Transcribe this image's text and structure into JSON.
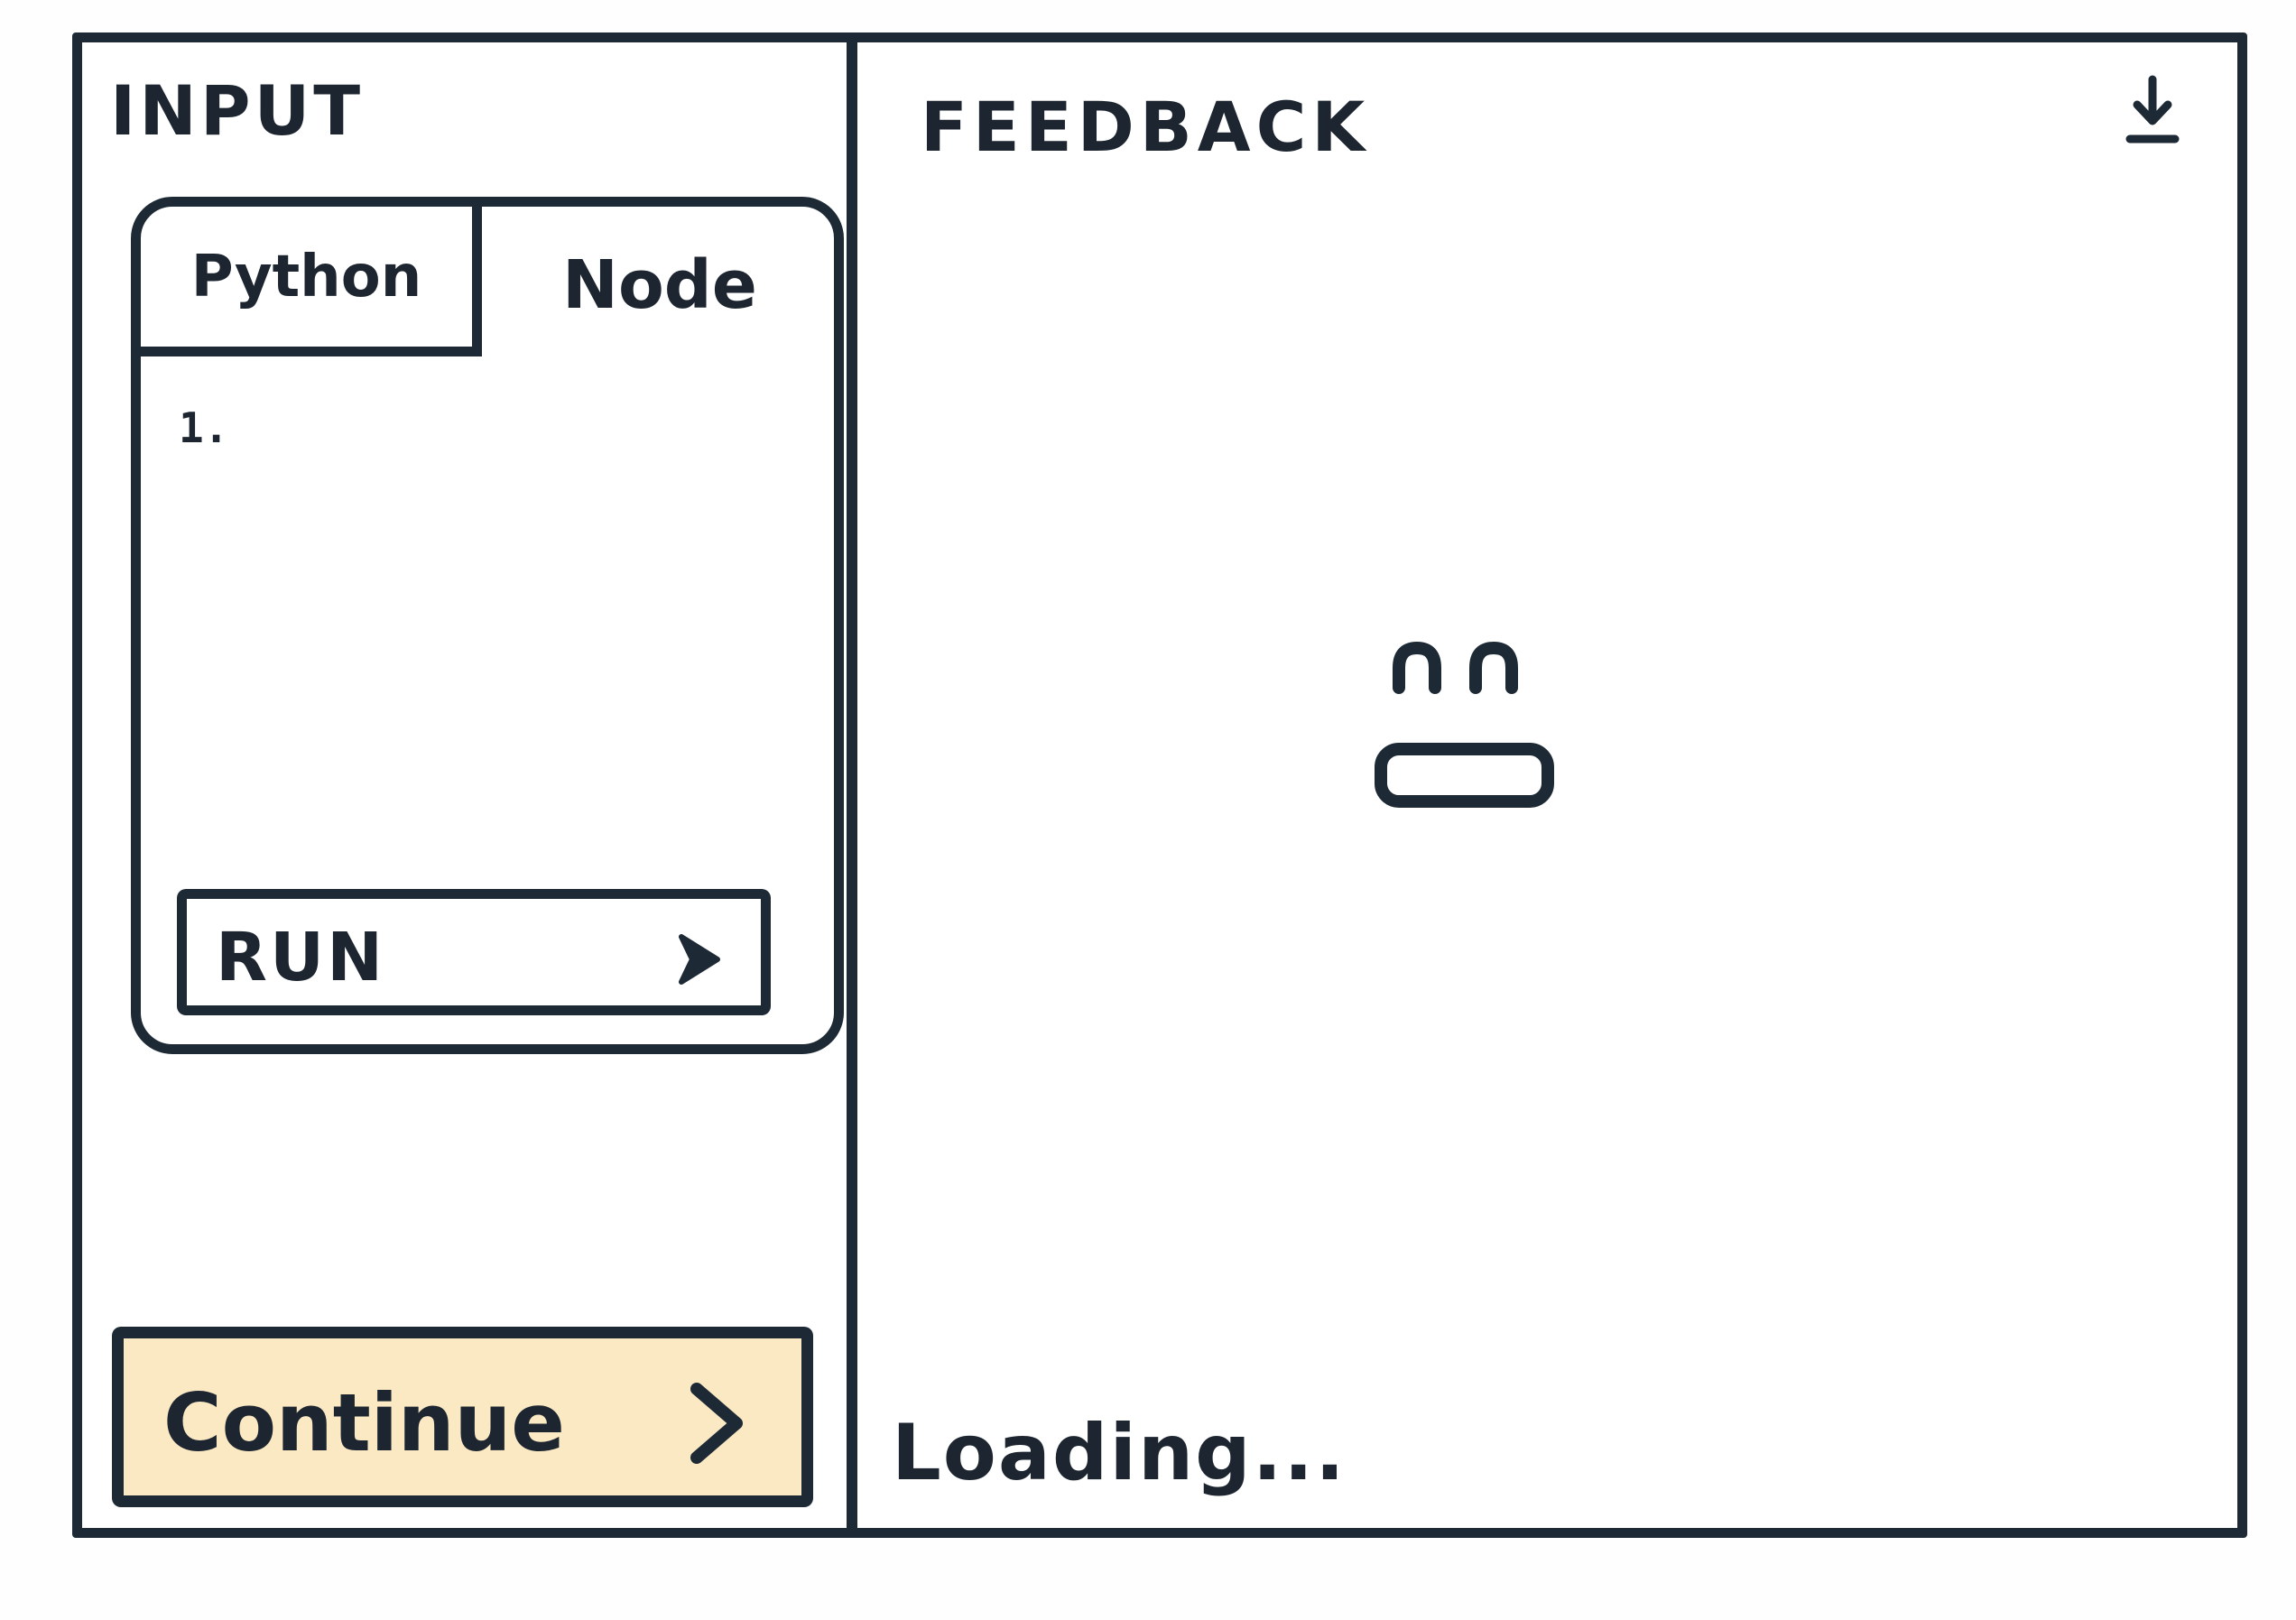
{
  "input_panel": {
    "title": "INPUT",
    "editor": {
      "tabs": [
        {
          "label": "Python",
          "active": true
        },
        {
          "label": "Node",
          "active": false
        }
      ],
      "line_numbers": [
        "1."
      ],
      "run_button": {
        "label": "RUN",
        "icon": "chevron-right-icon"
      }
    },
    "continue_button": {
      "label": "Continue",
      "icon": "chevron-right-icon",
      "background": "#fbe9c4"
    }
  },
  "feedback_panel": {
    "title": "FEEDBACK",
    "download_icon": "download-icon",
    "status_icon": "placeholder-face-icon",
    "loading_text": "Loading..."
  },
  "colors": {
    "ink": "#1d2a35",
    "continue_fill": "#fbe9c4"
  }
}
